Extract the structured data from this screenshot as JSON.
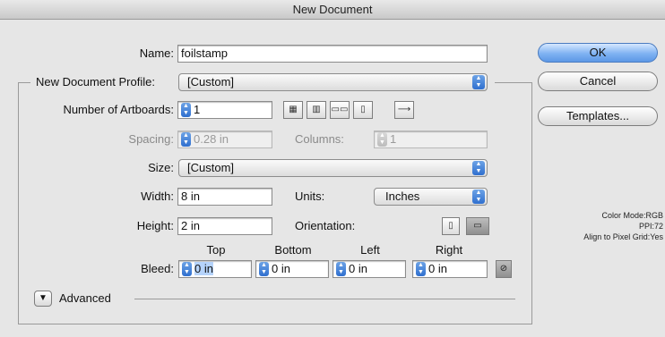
{
  "window": {
    "title": "New Document"
  },
  "form": {
    "name_label": "Name:",
    "name_value": "foilstamp",
    "profile_label": "New Document Profile:",
    "profile_value": "[Custom]",
    "artboards_label": "Number of Artboards:",
    "artboards_value": "1",
    "spacing_label": "Spacing:",
    "spacing_value": "0.28 in",
    "columns_label": "Columns:",
    "columns_value": "1",
    "size_label": "Size:",
    "size_value": "[Custom]",
    "width_label": "Width:",
    "width_value": "8 in",
    "units_label": "Units:",
    "units_value": "Inches",
    "height_label": "Height:",
    "height_value": "2 in",
    "orientation_label": "Orientation:",
    "bleed_label": "Bleed:",
    "bleed_headers": {
      "top": "Top",
      "bottom": "Bottom",
      "left": "Left",
      "right": "Right"
    },
    "bleed_values": {
      "top_num": "0",
      "top_unit": "in",
      "bottom": "0 in",
      "left": "0 in",
      "right": "0 in"
    },
    "advanced_label": "Advanced"
  },
  "buttons": {
    "ok": "OK",
    "cancel": "Cancel",
    "templates": "Templates..."
  },
  "info": {
    "color_mode": "Color Mode:RGB",
    "ppi": "PPI:72",
    "align": "Align to Pixel Grid:Yes"
  },
  "icons": {
    "grid_by_row": "grid-by-row-icon",
    "grid_by_column": "grid-by-column-icon",
    "arrange_row": "arrange-by-row-icon",
    "arrange_column": "arrange-by-column-icon",
    "layout_direction": "arrow-right-icon",
    "portrait": "portrait-icon",
    "landscape": "landscape-icon",
    "link_bleed": "link-icon",
    "disclosure": "disclosure-triangle-icon"
  },
  "colors": {
    "accent": "#3b7ad9",
    "background": "#e6e6e6"
  }
}
